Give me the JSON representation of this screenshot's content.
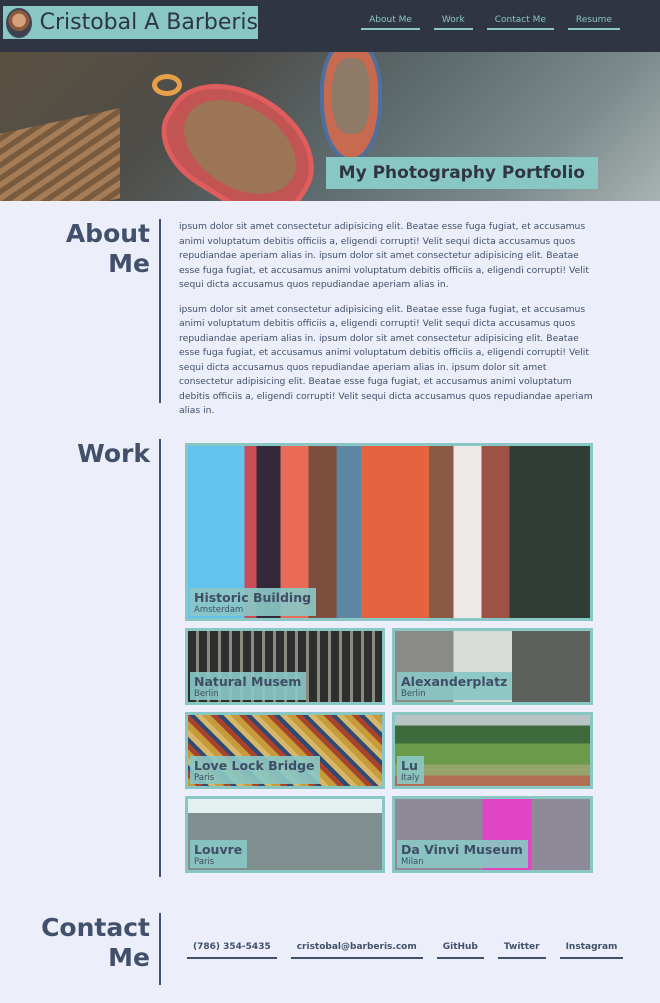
{
  "header": {
    "name": "Cristobal A Barberis",
    "nav": [
      "About Me",
      "Work",
      "Contact Me",
      "Resume"
    ]
  },
  "hero": {
    "tagline": "My Photography Portfolio"
  },
  "about": {
    "title_line1": "About",
    "title_line2": "Me",
    "paragraphs": [
      "ipsum dolor sit amet consectetur adipisicing elit. Beatae esse fuga fugiat, et accusamus animi voluptatum debitis officiis a, eligendi corrupti! Velit sequi dicta accusamus quos repudiandae aperiam alias in. ipsum dolor sit amet consectetur adipisicing elit. Beatae esse fuga fugiat, et accusamus animi voluptatum debitis officiis a, eligendi corrupti! Velit sequi dicta accusamus quos repudiandae aperiam alias in.",
      "ipsum dolor sit amet consectetur adipisicing elit. Beatae esse fuga fugiat, et accusamus animi voluptatum debitis officiis a, eligendi corrupti! Velit sequi dicta accusamus quos repudiandae aperiam alias in. ipsum dolor sit amet consectetur adipisicing elit. Beatae esse fuga fugiat, et accusamus animi voluptatum debitis officiis a, eligendi corrupti! Velit sequi dicta accusamus quos repudiandae aperiam alias in. ipsum dolor sit amet consectetur adipisicing elit. Beatae esse fuga fugiat, et accusamus animi voluptatum debitis officiis a, eligendi corrupti! Velit sequi dicta accusamus quos repudiandae aperiam alias in."
    ]
  },
  "work": {
    "title": "Work",
    "items": [
      {
        "title": "Historic Building",
        "city": "Amsterdam"
      },
      {
        "title": "Natural Musem",
        "city": "Berlin"
      },
      {
        "title": "Alexanderplatz",
        "city": "Berlin"
      },
      {
        "title": "Love Lock Bridge",
        "city": "Paris"
      },
      {
        "title": "Lu",
        "city": "Italy"
      },
      {
        "title": "Louvre",
        "city": "Paris"
      },
      {
        "title": "Da Vinvi Museum",
        "city": "Milan"
      }
    ]
  },
  "contact": {
    "title_line1": "Contact",
    "title_line2": "Me",
    "links": [
      "(786) 354-5435",
      "cristobal@barberis.com",
      "GitHub",
      "Twitter",
      "Instagram"
    ]
  },
  "colors": {
    "header_bg": "#2f3542",
    "accent": "#89c7c4",
    "text": "#41506b",
    "page_bg": "#eceefa"
  }
}
